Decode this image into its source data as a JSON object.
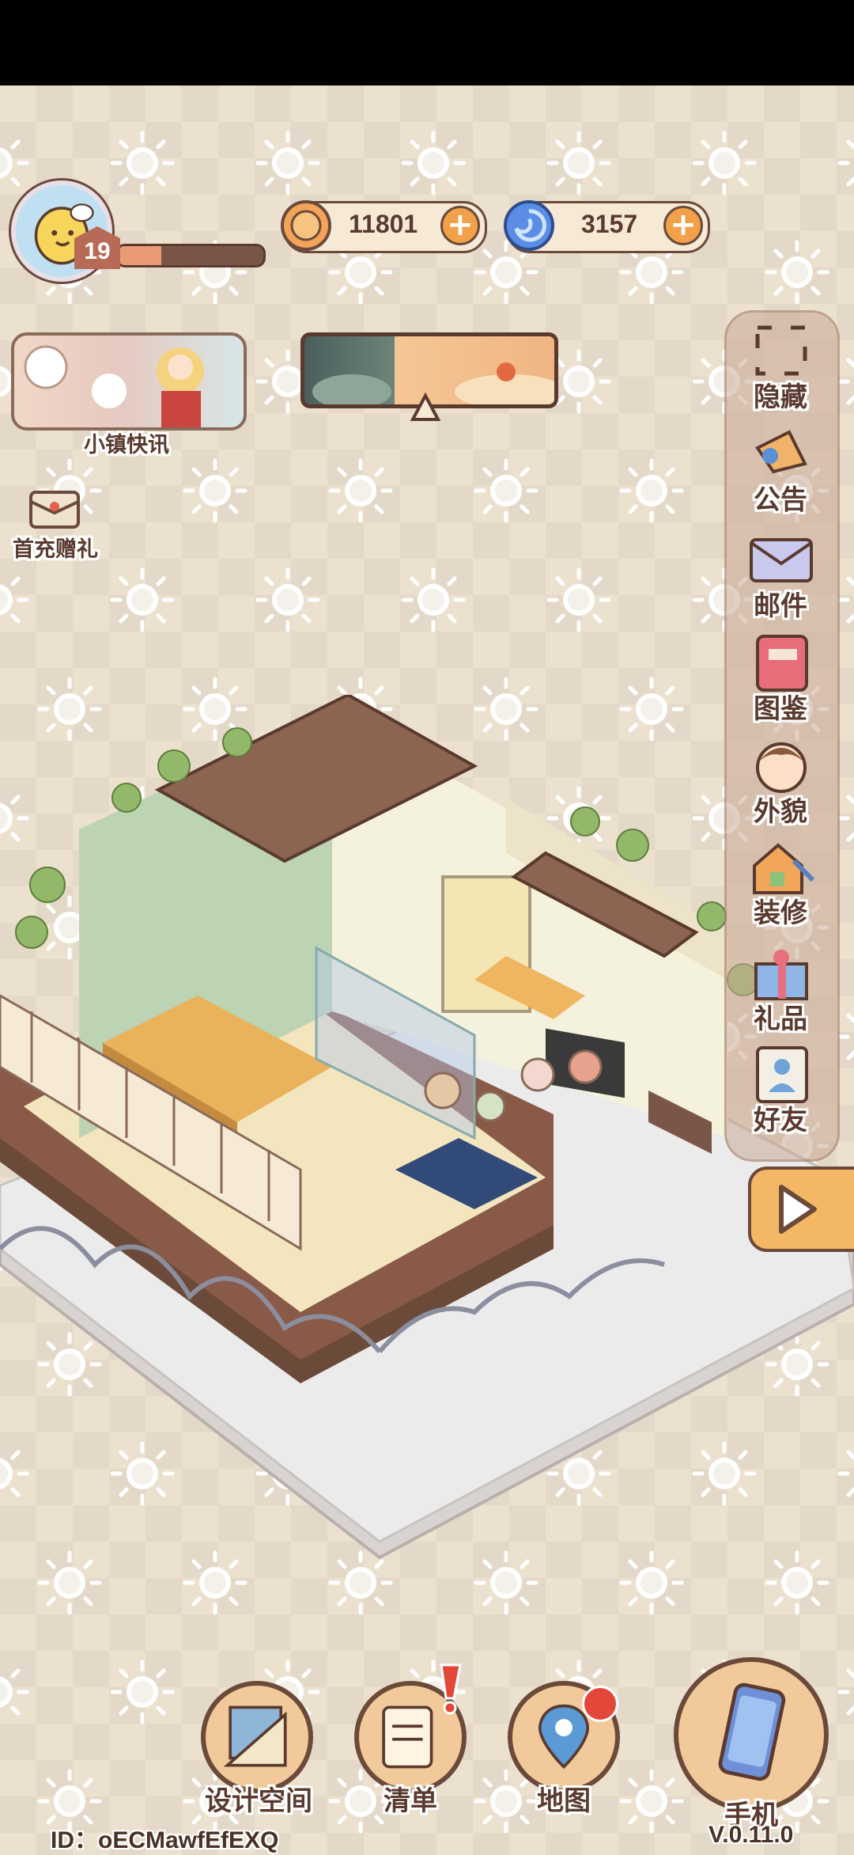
{
  "player": {
    "level": "19",
    "xp_fraction": 0.3
  },
  "currency": {
    "coins": {
      "value": "11801",
      "icon": "coin-icon"
    },
    "gems": {
      "value": "3157",
      "icon": "swirl-gem-icon"
    }
  },
  "news": {
    "label": "小镇快讯"
  },
  "first_recharge": {
    "label": "首充赠礼"
  },
  "side_menu": [
    {
      "label": "隐藏",
      "icon": "hide-frame-icon"
    },
    {
      "label": "公告",
      "icon": "megaphone-icon"
    },
    {
      "label": "邮件",
      "icon": "mail-icon"
    },
    {
      "label": "图鉴",
      "icon": "book-icon"
    },
    {
      "label": "外貌",
      "icon": "face-icon"
    },
    {
      "label": "装修",
      "icon": "house-wrench-icon"
    },
    {
      "label": "礼品",
      "icon": "gift-icon"
    },
    {
      "label": "好友",
      "icon": "friends-icon"
    }
  ],
  "bottom_bar": {
    "design": "设计空间",
    "list": "清单",
    "map": "地图",
    "phone": "手机"
  },
  "footer": {
    "id": "ID：oECMawfEfEXQ",
    "version": "V.0.11.0"
  },
  "colors": {
    "background": "#ece1cf",
    "accent_orange": "#f1a14a",
    "outline_brown": "#5a3a2e"
  }
}
